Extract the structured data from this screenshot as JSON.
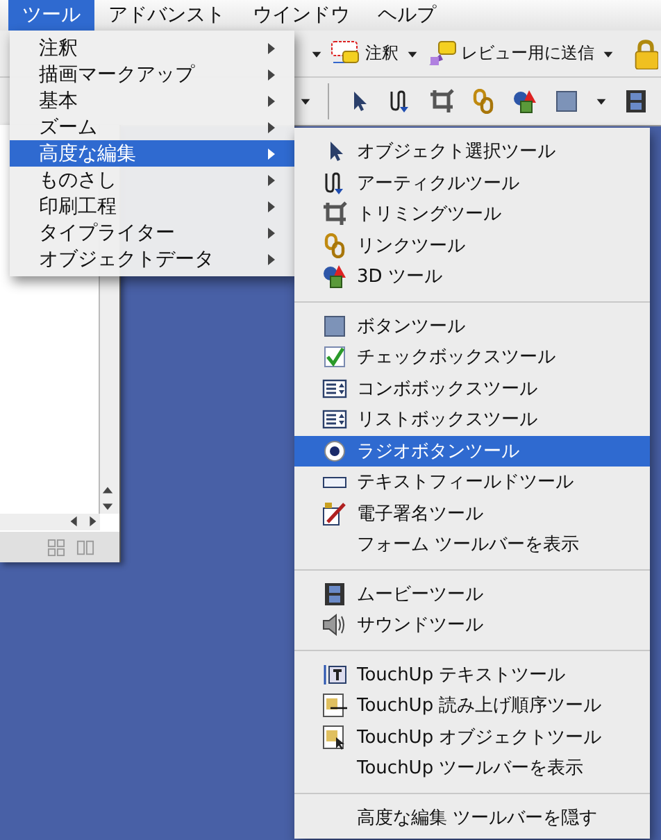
{
  "menu_bar": {
    "items": [
      {
        "label": "ツール",
        "selected": true
      },
      {
        "label": "アドバンスト",
        "selected": false
      },
      {
        "label": "ウインドウ",
        "selected": false
      },
      {
        "label": "ヘルプ",
        "selected": false
      }
    ]
  },
  "toolbar": {
    "buttons": [
      {
        "label": "注釈"
      },
      {
        "label": "レビュー用に送信"
      }
    ]
  },
  "tools_menu": {
    "items": [
      {
        "label": "注釈",
        "selected": false
      },
      {
        "label": "描画マークアップ",
        "selected": false
      },
      {
        "label": "基本",
        "selected": false
      },
      {
        "label": "ズーム",
        "selected": false
      },
      {
        "label": "高度な編集",
        "selected": true
      },
      {
        "label": "ものさし",
        "selected": false
      },
      {
        "label": "印刷工程",
        "selected": false
      },
      {
        "label": "タイプライター",
        "selected": false
      },
      {
        "label": "オブジェクトデータ",
        "selected": false
      }
    ]
  },
  "advanced_editing_submenu": {
    "groups": [
      {
        "items": [
          {
            "label": "オブジェクト選択ツール",
            "kind": "tool",
            "selected": false
          },
          {
            "label": "アーティクルツール",
            "kind": "tool",
            "selected": false
          },
          {
            "label": "トリミングツール",
            "kind": "tool",
            "selected": false
          },
          {
            "label": "リンクツール",
            "kind": "tool",
            "selected": false
          },
          {
            "label": "3D ツール",
            "kind": "tool",
            "selected": false
          }
        ]
      },
      {
        "items": [
          {
            "label": "ボタンツール",
            "kind": "tool",
            "selected": false
          },
          {
            "label": "チェックボックスツール",
            "kind": "tool",
            "selected": false
          },
          {
            "label": "コンボボックスツール",
            "kind": "tool",
            "selected": false
          },
          {
            "label": "リストボックスツール",
            "kind": "tool",
            "selected": false
          },
          {
            "label": "ラジオボタンツール",
            "kind": "tool",
            "selected": true
          },
          {
            "label": "テキストフィールドツール",
            "kind": "tool",
            "selected": false
          },
          {
            "label": "電子署名ツール",
            "kind": "tool",
            "selected": false
          },
          {
            "label": "フォーム ツールバーを表示",
            "kind": "command",
            "selected": false
          }
        ]
      },
      {
        "items": [
          {
            "label": "ムービーツール",
            "kind": "tool",
            "selected": false
          },
          {
            "label": "サウンドツール",
            "kind": "tool",
            "selected": false
          }
        ]
      },
      {
        "items": [
          {
            "label": "TouchUp テキストツール",
            "kind": "tool",
            "selected": false
          },
          {
            "label": "TouchUp 読み上げ順序ツール",
            "kind": "tool",
            "selected": false
          },
          {
            "label": "TouchUp オブジェクトツール",
            "kind": "tool",
            "selected": false
          },
          {
            "label": "TouchUp  ツールバーを表示",
            "kind": "command",
            "selected": false
          }
        ]
      },
      {
        "items": [
          {
            "label": "高度な編集 ツールバーを隠す",
            "kind": "command",
            "selected": false
          }
        ]
      }
    ]
  }
}
